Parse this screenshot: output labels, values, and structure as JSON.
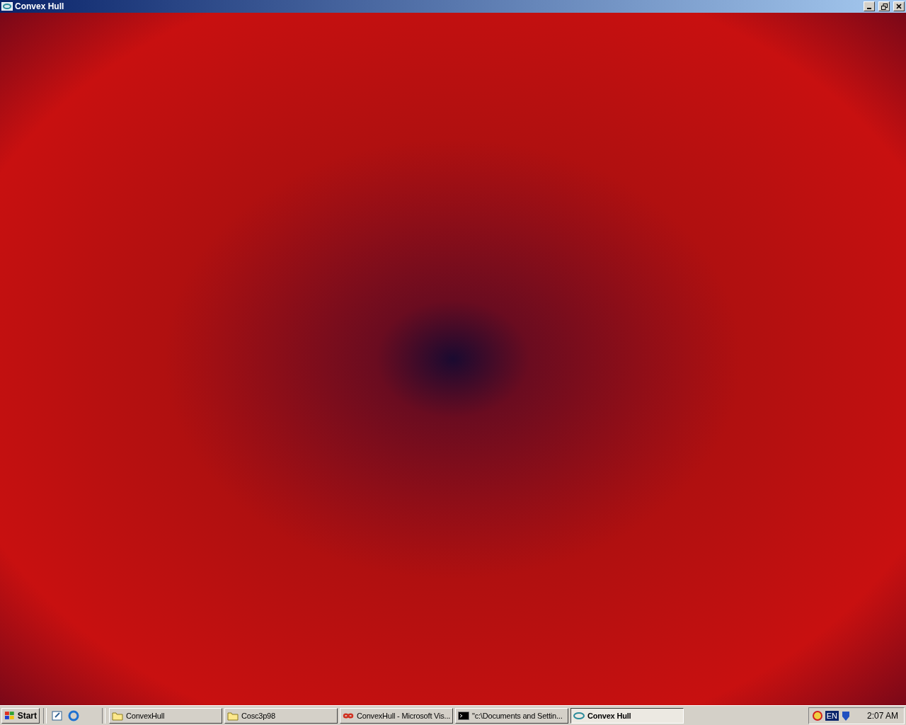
{
  "window": {
    "title": "Convex Hull"
  },
  "taskbar": {
    "start_label": "Start",
    "tasks": [
      {
        "label": "ConvexHull",
        "kind": "folder",
        "selected": false
      },
      {
        "label": "Cosc3p98",
        "kind": "folder",
        "selected": false
      },
      {
        "label": "ConvexHull - Microsoft Vis...",
        "kind": "studio",
        "selected": false
      },
      {
        "label": "\"c:\\Documents and Settin...",
        "kind": "console",
        "selected": false
      },
      {
        "label": "Convex Hull",
        "kind": "app",
        "selected": true
      }
    ],
    "language": "EN",
    "clock": "2:07 AM"
  }
}
